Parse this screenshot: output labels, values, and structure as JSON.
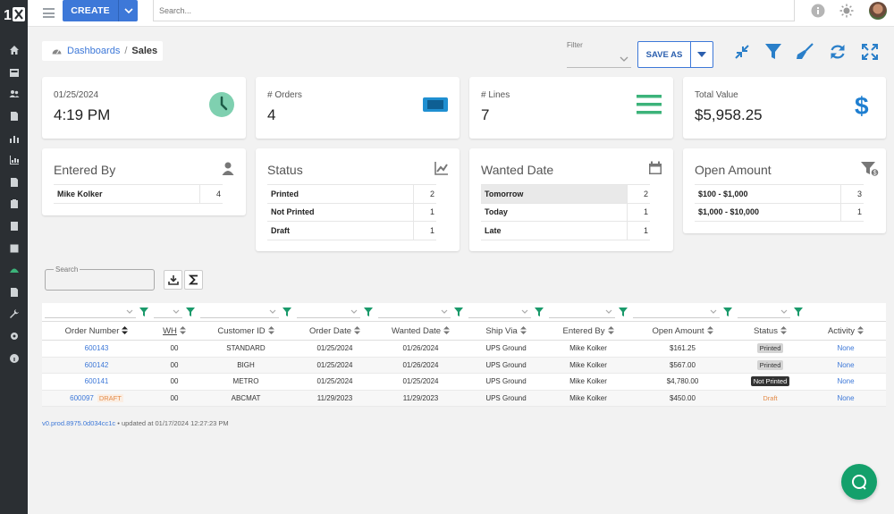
{
  "app": {
    "logo_text": "1"
  },
  "topbar": {
    "create_label": "CREATE",
    "search_placeholder": "Search..."
  },
  "breadcrumb": {
    "root": "Dashboards",
    "sep": "/",
    "current": "Sales"
  },
  "filter": {
    "label": "Filter",
    "value": ""
  },
  "toolbar": {
    "save_as_label": "SAVE AS"
  },
  "kpis": [
    {
      "label": "01/25/2024",
      "value": "4:19 PM",
      "icon": "clock-icon"
    },
    {
      "label": "# Orders",
      "value": "4",
      "icon": "ticket-icon"
    },
    {
      "label": "# Lines",
      "value": "7",
      "icon": "lines-icon"
    },
    {
      "label": "Total Value",
      "value": "$5,958.25",
      "icon": "dollar-icon"
    }
  ],
  "dimensions": [
    {
      "title": "Entered By",
      "icon": "user-icon",
      "rows": [
        {
          "key": "Mike Kolker",
          "count": "4"
        }
      ]
    },
    {
      "title": "Status",
      "icon": "trend-icon",
      "rows": [
        {
          "key": "Printed",
          "count": "2"
        },
        {
          "key": "Not Printed",
          "count": "1"
        },
        {
          "key": "Draft",
          "count": "1"
        }
      ]
    },
    {
      "title": "Wanted Date",
      "icon": "calendar-icon",
      "rows": [
        {
          "key": "Tomorrow",
          "count": "2"
        },
        {
          "key": "Today",
          "count": "1"
        },
        {
          "key": "Late",
          "count": "1"
        }
      ]
    },
    {
      "title": "Open Amount",
      "icon": "funnel-dollar-icon",
      "rows": [
        {
          "key": "$100 - $1,000",
          "count": "3"
        },
        {
          "key": "$1,000 - $10,000",
          "count": "1"
        }
      ]
    }
  ],
  "grid": {
    "search_label": "Search",
    "columns": [
      "Order Number",
      "WH",
      "Customer ID",
      "Order Date",
      "Wanted Date",
      "Ship Via",
      "Entered By",
      "Open Amount",
      "Status",
      "Activity"
    ],
    "rows": [
      {
        "order": "600143",
        "tag": "",
        "wh": "00",
        "customer": "STANDARD",
        "order_date": "01/25/2024",
        "wanted_date": "01/26/2024",
        "ship_via": "UPS Ground",
        "entered_by": "Mike Kolker",
        "open_amount": "$161.25",
        "status": "Printed",
        "activity": "None"
      },
      {
        "order": "600142",
        "tag": "",
        "wh": "00",
        "customer": "BIGH",
        "order_date": "01/25/2024",
        "wanted_date": "01/26/2024",
        "ship_via": "UPS Ground",
        "entered_by": "Mike Kolker",
        "open_amount": "$567.00",
        "status": "Printed",
        "activity": "None"
      },
      {
        "order": "600141",
        "tag": "",
        "wh": "00",
        "customer": "METRO",
        "order_date": "01/25/2024",
        "wanted_date": "01/25/2024",
        "ship_via": "UPS Ground",
        "entered_by": "Mike Kolker",
        "open_amount": "$4,780.00",
        "status": "Not Printed",
        "activity": "None"
      },
      {
        "order": "600097",
        "tag": "DRAFT",
        "wh": "00",
        "customer": "ABCMAT",
        "order_date": "11/29/2023",
        "wanted_date": "11/29/2023",
        "ship_via": "UPS Ground",
        "entered_by": "Mike Kolker",
        "open_amount": "$450.00",
        "status": "Draft",
        "activity": "None"
      }
    ]
  },
  "footer": {
    "version": "v0.prod.8975.0d034cc1c",
    "updated": " • updated at 01/17/2024 12:27:23 PM"
  },
  "colors": {
    "accent": "#3d78d8",
    "green": "#14a06b",
    "sidebar": "#2b2f33"
  }
}
